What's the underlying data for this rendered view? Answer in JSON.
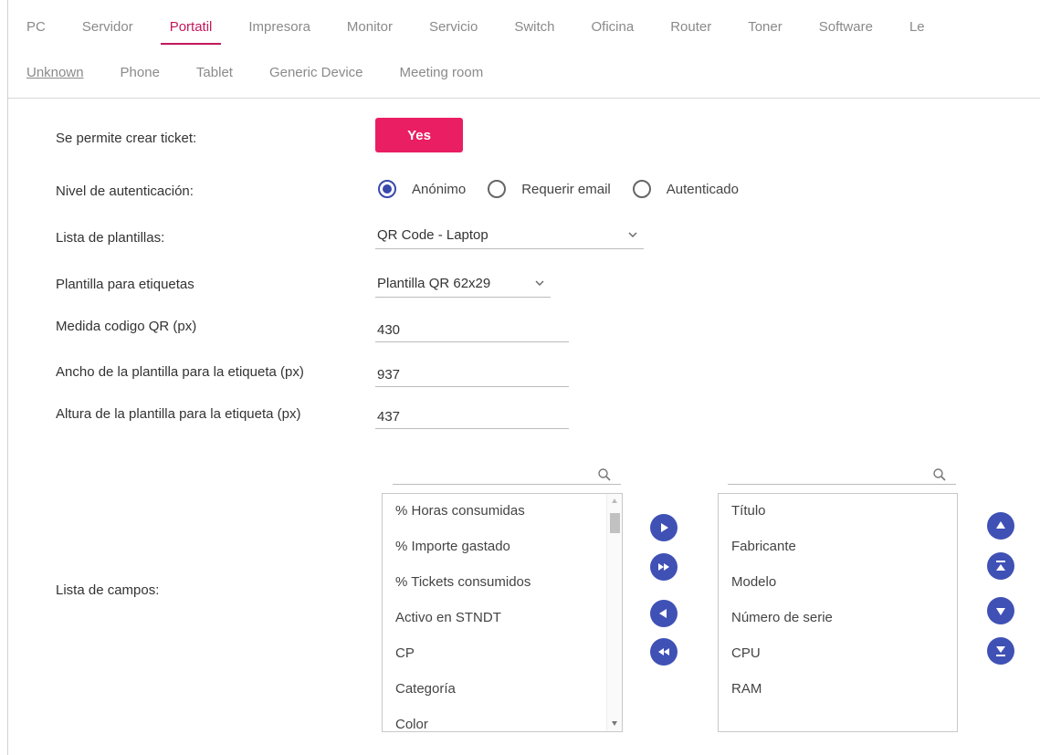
{
  "tabs_row1": [
    {
      "label": "PC",
      "active": false
    },
    {
      "label": "Servidor",
      "active": false
    },
    {
      "label": "Portatil",
      "active": true
    },
    {
      "label": "Impresora",
      "active": false
    },
    {
      "label": "Monitor",
      "active": false
    },
    {
      "label": "Servicio",
      "active": false
    },
    {
      "label": "Switch",
      "active": false
    },
    {
      "label": "Oficina",
      "active": false
    },
    {
      "label": "Router",
      "active": false
    },
    {
      "label": "Toner",
      "active": false
    },
    {
      "label": "Software",
      "active": false
    },
    {
      "label": "Le",
      "active": false
    }
  ],
  "tabs_row2": [
    {
      "label": "Unknown"
    },
    {
      "label": "Phone"
    },
    {
      "label": "Tablet"
    },
    {
      "label": "Generic Device"
    },
    {
      "label": "Meeting room"
    }
  ],
  "form": {
    "ticket_label": "Se permite crear ticket:",
    "ticket_value": "Yes",
    "auth_label": "Nivel de autenticación:",
    "auth_options": [
      "Anónimo",
      "Requerir email",
      "Autenticado"
    ],
    "auth_selected": "Anónimo",
    "templates_label": "Lista de plantillas:",
    "templates_value": "QR Code - Laptop",
    "label_template_label": "Plantilla para etiquetas",
    "label_template_value": "Plantilla QR 62x29",
    "qr_size_label": "Medida codigo QR (px)",
    "qr_size_value": "430",
    "width_label": "Ancho de la plantilla para la etiqueta (px)",
    "width_value": "937",
    "height_label": "Altura de la plantilla para la etiqueta (px)",
    "height_value": "437",
    "fields_label": "Lista de campos:"
  },
  "available_fields": [
    "% Horas consumidas",
    "% Importe gastado",
    "% Tickets consumidos",
    "Activo en STNDT",
    "CP",
    "Categoría",
    "Color"
  ],
  "selected_fields": [
    "Título",
    "Fabricante",
    "Modelo",
    "Número de serie",
    "CPU",
    "RAM"
  ],
  "colors": {
    "accent": "#c2185b",
    "yes_button": "#e91e63",
    "action_button": "#3f51b5"
  },
  "icons": {
    "transfer_buttons": [
      "move-right-icon",
      "move-all-right-icon",
      "move-left-icon",
      "move-all-left-icon"
    ],
    "order_buttons": [
      "move-up-icon",
      "move-top-icon",
      "move-down-icon",
      "move-bottom-icon"
    ]
  }
}
